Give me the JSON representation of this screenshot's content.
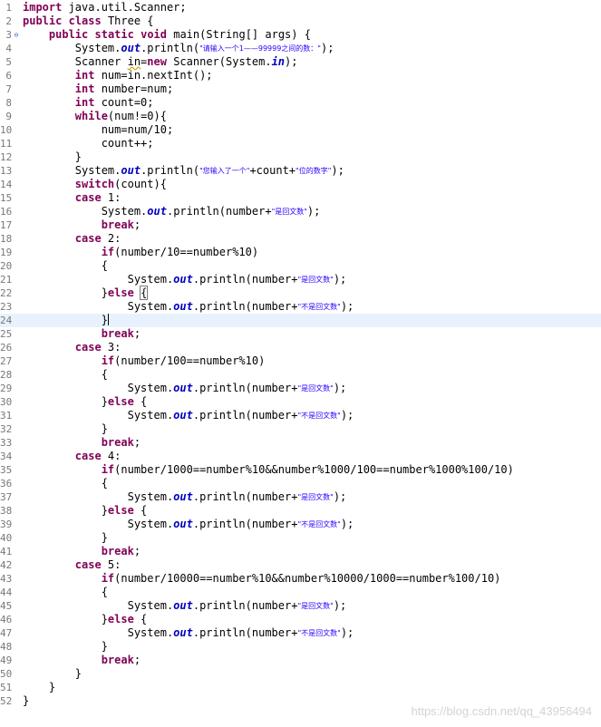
{
  "editor": {
    "lines": [
      {
        "n": "1",
        "tokens": [
          {
            "t": "import",
            "c": "kw"
          },
          {
            "t": " java.util.Scanner;"
          }
        ]
      },
      {
        "n": "2",
        "tokens": [
          {
            "t": "public",
            "c": "kw"
          },
          {
            "t": " "
          },
          {
            "t": "class",
            "c": "kw"
          },
          {
            "t": " Three {"
          }
        ]
      },
      {
        "n": "3",
        "fold": "⊖",
        "tokens": [
          {
            "t": "    "
          },
          {
            "t": "public",
            "c": "kw"
          },
          {
            "t": " "
          },
          {
            "t": "static",
            "c": "kw"
          },
          {
            "t": " "
          },
          {
            "t": "void",
            "c": "kw"
          },
          {
            "t": " main(String[] args) {"
          }
        ]
      },
      {
        "n": "4",
        "tokens": [
          {
            "t": "        System."
          },
          {
            "t": "out",
            "c": "fld"
          },
          {
            "t": ".println("
          },
          {
            "t": "\"请输入一个1——99999之间的数：\"",
            "c": "str"
          },
          {
            "t": ");"
          }
        ]
      },
      {
        "n": "5",
        "tokens": [
          {
            "t": "        Scanner "
          },
          {
            "t": "in",
            "c": "warn"
          },
          {
            "t": "="
          },
          {
            "t": "new",
            "c": "kw"
          },
          {
            "t": " Scanner(System."
          },
          {
            "t": "in",
            "c": "fld"
          },
          {
            "t": ");"
          }
        ]
      },
      {
        "n": "6",
        "tokens": [
          {
            "t": "        "
          },
          {
            "t": "int",
            "c": "kw"
          },
          {
            "t": " num=in.nextInt();"
          }
        ]
      },
      {
        "n": "7",
        "tokens": [
          {
            "t": "        "
          },
          {
            "t": "int",
            "c": "kw"
          },
          {
            "t": " number=num;"
          }
        ]
      },
      {
        "n": "8",
        "tokens": [
          {
            "t": "        "
          },
          {
            "t": "int",
            "c": "kw"
          },
          {
            "t": " count=0;"
          }
        ]
      },
      {
        "n": "9",
        "tokens": [
          {
            "t": "        "
          },
          {
            "t": "while",
            "c": "kw"
          },
          {
            "t": "(num!=0){"
          }
        ]
      },
      {
        "n": "10",
        "tokens": [
          {
            "t": "            num=num/10;"
          }
        ]
      },
      {
        "n": "11",
        "tokens": [
          {
            "t": "            count++;"
          }
        ]
      },
      {
        "n": "12",
        "tokens": [
          {
            "t": "        }"
          }
        ]
      },
      {
        "n": "13",
        "tokens": [
          {
            "t": "        System."
          },
          {
            "t": "out",
            "c": "fld"
          },
          {
            "t": ".println("
          },
          {
            "t": "\"您输入了一个\"",
            "c": "str"
          },
          {
            "t": "+count+"
          },
          {
            "t": "\"位的数字\"",
            "c": "str"
          },
          {
            "t": ");"
          }
        ]
      },
      {
        "n": "14",
        "tokens": [
          {
            "t": "        "
          },
          {
            "t": "switch",
            "c": "kw"
          },
          {
            "t": "(count){"
          }
        ]
      },
      {
        "n": "15",
        "tokens": [
          {
            "t": "        "
          },
          {
            "t": "case",
            "c": "kw"
          },
          {
            "t": " 1:"
          }
        ]
      },
      {
        "n": "16",
        "tokens": [
          {
            "t": "            System."
          },
          {
            "t": "out",
            "c": "fld"
          },
          {
            "t": ".println(number+"
          },
          {
            "t": "\"是回文数\"",
            "c": "str"
          },
          {
            "t": ");"
          }
        ]
      },
      {
        "n": "17",
        "tokens": [
          {
            "t": "            "
          },
          {
            "t": "break",
            "c": "kw"
          },
          {
            "t": ";"
          }
        ]
      },
      {
        "n": "18",
        "tokens": [
          {
            "t": "        "
          },
          {
            "t": "case",
            "c": "kw"
          },
          {
            "t": " 2:"
          }
        ]
      },
      {
        "n": "19",
        "tokens": [
          {
            "t": "            "
          },
          {
            "t": "if",
            "c": "kw"
          },
          {
            "t": "(number/10==number%10)"
          }
        ]
      },
      {
        "n": "20",
        "tokens": [
          {
            "t": "            {"
          }
        ]
      },
      {
        "n": "21",
        "tokens": [
          {
            "t": "                System."
          },
          {
            "t": "out",
            "c": "fld"
          },
          {
            "t": ".println(number+"
          },
          {
            "t": "\"是回文数\"",
            "c": "str"
          },
          {
            "t": ");"
          }
        ]
      },
      {
        "n": "22",
        "tokens": [
          {
            "t": "            }"
          },
          {
            "t": "else",
            "c": "kw"
          },
          {
            "t": " "
          },
          {
            "t": "{",
            "c": "bracket"
          }
        ]
      },
      {
        "n": "23",
        "tokens": [
          {
            "t": "                System."
          },
          {
            "t": "out",
            "c": "fld"
          },
          {
            "t": ".println(number+"
          },
          {
            "t": "\"不是回文数\"",
            "c": "str"
          },
          {
            "t": ");"
          }
        ]
      },
      {
        "n": "24",
        "current": true,
        "tokens": [
          {
            "t": "            }"
          },
          {
            "t": "",
            "c": "caret"
          }
        ]
      },
      {
        "n": "25",
        "tokens": [
          {
            "t": "            "
          },
          {
            "t": "break",
            "c": "kw"
          },
          {
            "t": ";"
          }
        ]
      },
      {
        "n": "26",
        "tokens": [
          {
            "t": "        "
          },
          {
            "t": "case",
            "c": "kw"
          },
          {
            "t": " 3:"
          }
        ]
      },
      {
        "n": "27",
        "tokens": [
          {
            "t": "            "
          },
          {
            "t": "if",
            "c": "kw"
          },
          {
            "t": "(number/100==number%10)"
          }
        ]
      },
      {
        "n": "28",
        "tokens": [
          {
            "t": "            {"
          }
        ]
      },
      {
        "n": "29",
        "tokens": [
          {
            "t": "                System."
          },
          {
            "t": "out",
            "c": "fld"
          },
          {
            "t": ".println(number+"
          },
          {
            "t": "\"是回文数\"",
            "c": "str"
          },
          {
            "t": ");"
          }
        ]
      },
      {
        "n": "30",
        "tokens": [
          {
            "t": "            }"
          },
          {
            "t": "else",
            "c": "kw"
          },
          {
            "t": " {"
          }
        ]
      },
      {
        "n": "31",
        "tokens": [
          {
            "t": "                System."
          },
          {
            "t": "out",
            "c": "fld"
          },
          {
            "t": ".println(number+"
          },
          {
            "t": "\"不是回文数\"",
            "c": "str"
          },
          {
            "t": ");"
          }
        ]
      },
      {
        "n": "32",
        "tokens": [
          {
            "t": "            }"
          }
        ]
      },
      {
        "n": "33",
        "tokens": [
          {
            "t": "            "
          },
          {
            "t": "break",
            "c": "kw"
          },
          {
            "t": ";"
          }
        ]
      },
      {
        "n": "34",
        "tokens": [
          {
            "t": "        "
          },
          {
            "t": "case",
            "c": "kw"
          },
          {
            "t": " 4:"
          }
        ]
      },
      {
        "n": "35",
        "tokens": [
          {
            "t": "            "
          },
          {
            "t": "if",
            "c": "kw"
          },
          {
            "t": "(number/1000==number%10&&number%1000/100==number%1000%100/10)"
          }
        ]
      },
      {
        "n": "36",
        "tokens": [
          {
            "t": "            {"
          }
        ]
      },
      {
        "n": "37",
        "tokens": [
          {
            "t": "                System."
          },
          {
            "t": "out",
            "c": "fld"
          },
          {
            "t": ".println(number+"
          },
          {
            "t": "\"是回文数\"",
            "c": "str"
          },
          {
            "t": ");"
          }
        ]
      },
      {
        "n": "38",
        "tokens": [
          {
            "t": "            }"
          },
          {
            "t": "else",
            "c": "kw"
          },
          {
            "t": " {"
          }
        ]
      },
      {
        "n": "39",
        "tokens": [
          {
            "t": "                System."
          },
          {
            "t": "out",
            "c": "fld"
          },
          {
            "t": ".println(number+"
          },
          {
            "t": "\"不是回文数\"",
            "c": "str"
          },
          {
            "t": ");"
          }
        ]
      },
      {
        "n": "40",
        "tokens": [
          {
            "t": "            }"
          }
        ]
      },
      {
        "n": "41",
        "tokens": [
          {
            "t": "            "
          },
          {
            "t": "break",
            "c": "kw"
          },
          {
            "t": ";"
          }
        ]
      },
      {
        "n": "42",
        "tokens": [
          {
            "t": "        "
          },
          {
            "t": "case",
            "c": "kw"
          },
          {
            "t": " 5:"
          }
        ]
      },
      {
        "n": "43",
        "tokens": [
          {
            "t": "            "
          },
          {
            "t": "if",
            "c": "kw"
          },
          {
            "t": "(number/10000==number%10&&number%10000/1000==number%100/10)"
          }
        ]
      },
      {
        "n": "44",
        "tokens": [
          {
            "t": "            {"
          }
        ]
      },
      {
        "n": "45",
        "tokens": [
          {
            "t": "                System."
          },
          {
            "t": "out",
            "c": "fld"
          },
          {
            "t": ".println(number+"
          },
          {
            "t": "\"是回文数\"",
            "c": "str"
          },
          {
            "t": ");"
          }
        ]
      },
      {
        "n": "46",
        "tokens": [
          {
            "t": "            }"
          },
          {
            "t": "else",
            "c": "kw"
          },
          {
            "t": " {"
          }
        ]
      },
      {
        "n": "47",
        "tokens": [
          {
            "t": "                System."
          },
          {
            "t": "out",
            "c": "fld"
          },
          {
            "t": ".println(number+"
          },
          {
            "t": "\"不是回文数\"",
            "c": "str"
          },
          {
            "t": ");"
          }
        ]
      },
      {
        "n": "48",
        "tokens": [
          {
            "t": "            }"
          }
        ]
      },
      {
        "n": "49",
        "tokens": [
          {
            "t": "            "
          },
          {
            "t": "break",
            "c": "kw"
          },
          {
            "t": ";"
          }
        ]
      },
      {
        "n": "50",
        "tokens": [
          {
            "t": "        }"
          }
        ]
      },
      {
        "n": "51",
        "tokens": [
          {
            "t": "    }"
          }
        ]
      },
      {
        "n": "52",
        "tokens": [
          {
            "t": "}"
          }
        ]
      }
    ]
  },
  "watermark": "https://blog.csdn.net/qq_43956494",
  "colors": {
    "keyword": "#7f0055",
    "field": "#0000c0",
    "string": "#2a00ff",
    "line_number": "#787878",
    "current_line": "#e8f2fe"
  },
  "icons": {
    "fold": "collapse-icon"
  }
}
